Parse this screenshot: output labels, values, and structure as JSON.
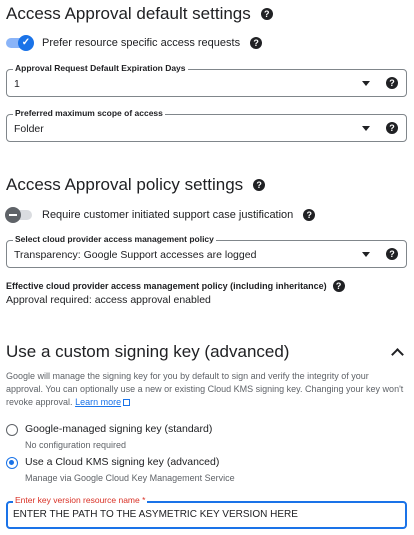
{
  "default_settings": {
    "title": "Access Approval default settings",
    "prefer_resource_toggle": {
      "label": "Prefer resource specific access requests",
      "on": true
    },
    "expiration": {
      "label": "Approval Request Default Expiration Days",
      "value": "1"
    },
    "scope": {
      "label": "Preferred maximum scope of access",
      "value": "Folder"
    }
  },
  "policy_settings": {
    "title": "Access Approval policy settings",
    "support_case_toggle": {
      "label": "Require customer initiated support case justification",
      "on": false
    },
    "cloud_provider_policy": {
      "label": "Select cloud provider access management policy",
      "value": "Transparency: Google Support accesses are logged"
    },
    "effective_policy": {
      "label": "Effective cloud provider access management policy (including inheritance)",
      "value": "Approval required: access approval enabled"
    }
  },
  "signing_key": {
    "title": "Use a custom signing key (advanced)",
    "description": "Google will manage the signing key for you by default to sign and verify the integrity of your approval. You can optionally use a new or existing Cloud KMS signing key. Changing your key won't revoke approval.",
    "learn_more": "Learn more",
    "options": [
      {
        "label": "Google-managed signing key (standard)",
        "sub": "No configuration required",
        "checked": false
      },
      {
        "label": "Use a Cloud KMS signing key (advanced)",
        "sub": "Manage via Google Cloud Key Management Service",
        "checked": true
      }
    ],
    "key_input": {
      "label": "Enter key version resource name *",
      "value": "ENTER THE PATH TO THE ASYMETRIC KEY VERSION HERE"
    }
  },
  "colors": {
    "accent": "#1a73e8",
    "required": "#d93025",
    "text": "#202124",
    "secondary": "#5f6368"
  },
  "icons": [
    "help-icon",
    "check-icon",
    "dropdown-arrow-icon",
    "chevron-up-icon",
    "external-link-icon"
  ]
}
